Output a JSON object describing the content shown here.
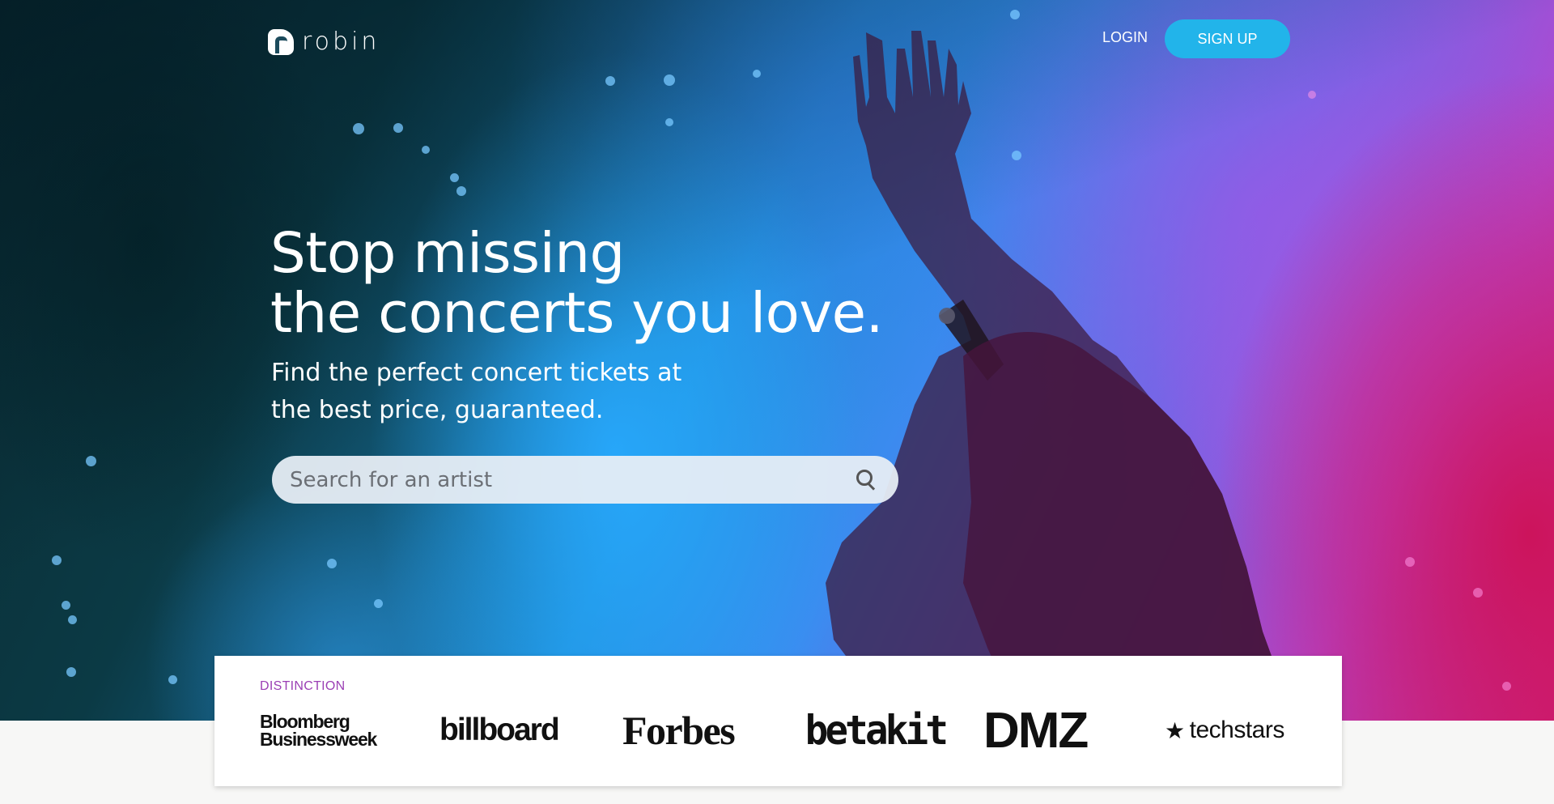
{
  "nav": {
    "logo_text": "robin",
    "login_label": "LOGIN",
    "signup_label": "SIGN UP"
  },
  "hero": {
    "headline_line1": "Stop missing",
    "headline_line2": "the concerts you love.",
    "sub_line1": "Find the perfect concert tickets at",
    "sub_line2": "the best price, guaranteed."
  },
  "search": {
    "placeholder": "Search for an artist",
    "value": "",
    "icon": "search-icon"
  },
  "distinction": {
    "label": "DISTINCTION",
    "logos": {
      "bloomberg_line1": "Bloomberg",
      "bloomberg_line2": "Businessweek",
      "billboard": "billboard",
      "forbes": "Forbes",
      "betakit": "betakit",
      "dmz": "DMZ",
      "techstars": "techstars"
    }
  },
  "colors": {
    "accent": "#22b4ea",
    "distinction_label": "#9b3fb4",
    "page_background": "#f7f7f6"
  }
}
